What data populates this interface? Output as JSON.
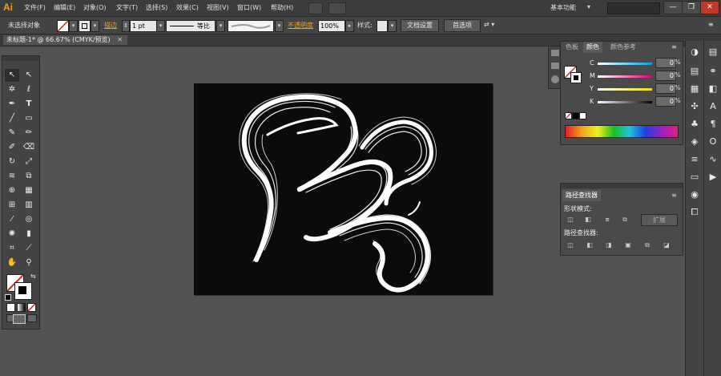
{
  "app": {
    "logo": "Ai",
    "workspace": "基本功能"
  },
  "menu": [
    "文件(F)",
    "编辑(E)",
    "对象(O)",
    "文字(T)",
    "选择(S)",
    "效果(C)",
    "视图(V)",
    "窗口(W)",
    "帮助(H)"
  ],
  "window_controls": {
    "minimize": "—",
    "restore": "❐",
    "close": "✕"
  },
  "control_bar": {
    "selection": "未选择对象",
    "stroke_label": "描边",
    "stroke_value": "1 pt",
    "stroke_style": "等比",
    "opacity_label": "不透明度",
    "opacity_value": "100%",
    "style_label": "样式:",
    "doc_setup": "文档设置",
    "preferences": "首选项"
  },
  "doc_tab": {
    "label": "未标题-1* @ 66.67% (CMYK/预览)"
  },
  "color_panel": {
    "tabs": [
      "色板",
      "颜色",
      "颜色参考"
    ],
    "active_tab": "颜色",
    "sliders": [
      {
        "label": "C",
        "value": "0",
        "unit": "%"
      },
      {
        "label": "M",
        "value": "0",
        "unit": "%"
      },
      {
        "label": "Y",
        "value": "0",
        "unit": "%"
      },
      {
        "label": "K",
        "value": "0",
        "unit": "%"
      }
    ]
  },
  "pathfinder_panel": {
    "title": "路径查找器",
    "shape_modes_label": "形状模式:",
    "expand_label": "扩展",
    "pathfinders_label": "路径查找器:"
  },
  "colors": {
    "accent": "#f79a1f",
    "artboard": "#0c0a0a",
    "ui_bg": "#535353"
  }
}
